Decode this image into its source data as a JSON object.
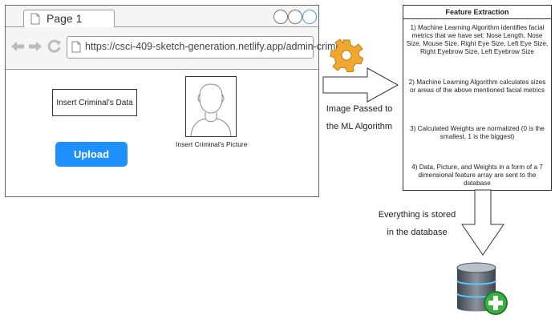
{
  "browser": {
    "tab_title": "Page 1",
    "url": "https://csci-409-sketch-generation.netlify.app/admin-criminal",
    "icons": [
      "back-arrow-icon",
      "forward-arrow-icon",
      "reload-icon",
      "page-icon"
    ]
  },
  "form": {
    "data_button": "Insert Criminal's Data",
    "upload_button": "Upload",
    "picture_caption": "Insert Criminal's Picture"
  },
  "flow": {
    "arrow_label_line1": "Image Passed to",
    "arrow_label_line2": "the ML Algorithm",
    "store_label_line1": "Everything is stored",
    "store_label_line2": "in the database"
  },
  "feature_extraction": {
    "title": "Feature Extraction",
    "steps": [
      "1) Machine Learning Algorithm identifies facial metrics that we have set: Nose Length, Nose Size, Mouse Size, Right Eye Size, Left Eye Size, Right Eyebrow Size, Left Eyebrow Size",
      "2) Machine Learning Algorithm calculates sizes or areas of the above mentioned facial metrics",
      "3) Calculated Weights are normalized (0 is the smallest, 1 is the biggest)",
      "4) Data, Picture, and Weights in a form of a 7 dimensional feature array are sent to the database"
    ]
  },
  "colors": {
    "upload_blue": "#1e90ff",
    "gear_orange": "#f0a830",
    "database_grey": "#5a6470",
    "plus_green": "#3cb043"
  }
}
